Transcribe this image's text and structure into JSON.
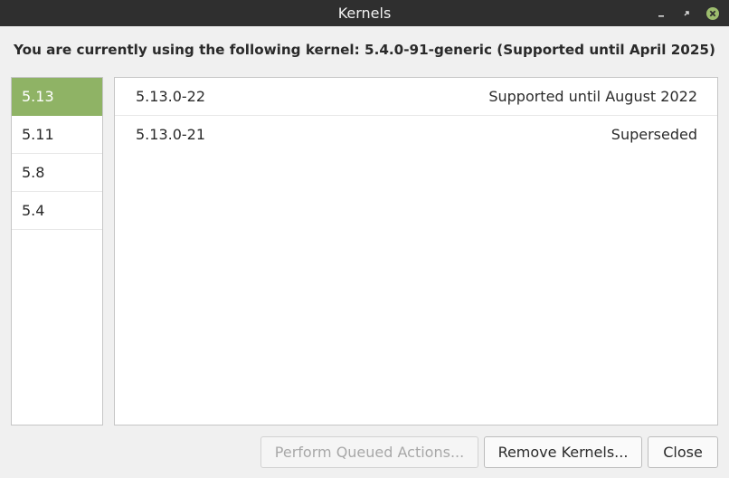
{
  "window": {
    "title": "Kernels"
  },
  "heading": "You are currently using the following kernel: 5.4.0-91-generic (Supported until April 2025)",
  "versions": [
    {
      "label": "5.13",
      "selected": true
    },
    {
      "label": "5.11",
      "selected": false
    },
    {
      "label": "5.8",
      "selected": false
    },
    {
      "label": "5.4",
      "selected": false
    }
  ],
  "kernels": [
    {
      "name": "5.13.0-22",
      "status": "Supported until August 2022"
    },
    {
      "name": "5.13.0-21",
      "status": "Superseded"
    }
  ],
  "buttons": {
    "perform": "Perform Queued Actions...",
    "remove": "Remove Kernels...",
    "close": "Close"
  },
  "colors": {
    "accent": "#8fb365",
    "titlebar": "#2f2f2f",
    "close_icon": "#9dbd6e"
  },
  "icons": {
    "minimize": "minimize-icon",
    "maximize": "maximize-icon",
    "close": "close-icon"
  }
}
